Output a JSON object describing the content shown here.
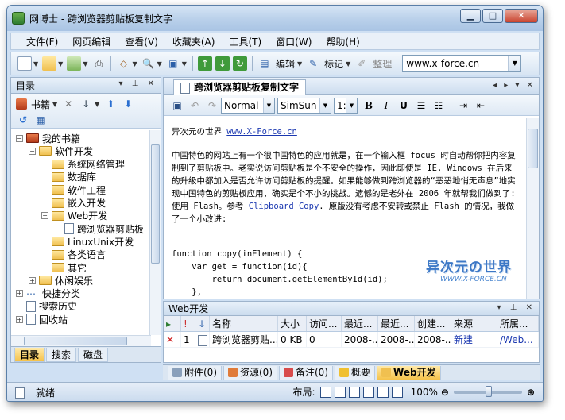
{
  "window": {
    "title": "网博士 - 跨浏览器剪贴板复制文字"
  },
  "menu": [
    "文件(F)",
    "网页编辑",
    "查看(V)",
    "收藏夹(A)",
    "工具(T)",
    "窗口(W)",
    "帮助(H)"
  ],
  "toolbar": {
    "edit_label": "编辑",
    "mark_label": "标记",
    "organize_label": "整理",
    "url_value": "www.x-force.cn"
  },
  "sidebar": {
    "title": "目录",
    "bookmarks_label": "书籍",
    "tree": [
      {
        "label": "我的书籍",
        "level": 0,
        "expand": "−",
        "type": "book"
      },
      {
        "label": "软件开发",
        "level": 1,
        "expand": "−",
        "type": "folder"
      },
      {
        "label": "系统网络管理",
        "level": 2,
        "expand": "",
        "type": "folder"
      },
      {
        "label": "数据库",
        "level": 2,
        "expand": "",
        "type": "folder"
      },
      {
        "label": "软件工程",
        "level": 2,
        "expand": "",
        "type": "folder"
      },
      {
        "label": "嵌入开发",
        "level": 2,
        "expand": "",
        "type": "folder"
      },
      {
        "label": "Web开发",
        "level": 2,
        "expand": "−",
        "type": "folder"
      },
      {
        "label": "跨浏览器剪贴板",
        "level": 3,
        "expand": "",
        "type": "doc"
      },
      {
        "label": "LinuxUnix开发",
        "level": 2,
        "expand": "",
        "type": "folder"
      },
      {
        "label": "各类语言",
        "level": 2,
        "expand": "",
        "type": "folder"
      },
      {
        "label": "其它",
        "level": 2,
        "expand": "",
        "type": "folder"
      },
      {
        "label": "休闲娱乐",
        "level": 1,
        "expand": "+",
        "type": "folder"
      },
      {
        "label": "快捷分类",
        "level": 0,
        "expand": "+",
        "type": "dots"
      },
      {
        "label": "搜索历史",
        "level": 0,
        "expand": "",
        "type": "doc"
      },
      {
        "label": "回收站",
        "level": 0,
        "expand": "+",
        "type": "doc"
      }
    ],
    "tabs": [
      "目录",
      "搜索",
      "磁盘"
    ]
  },
  "editor": {
    "tab_title": "跨浏览器剪贴板复制文字",
    "font_style": "Normal",
    "font_name": "SimSun-",
    "font_size": "1:",
    "content": {
      "site_name": "异次元の世界",
      "site_url": "www.X-Force.cn",
      "para_before_link": "中国特色的网站上有一个很中国特色的应用就是，在一个输入框 focus 时自动帮你把内容复制到了剪贴板中。老实说访问剪贴板是个不安全的操作，因此即使是 IE, Windows 在后来的升级中都加入是否允许访问剪贴板的提醒。如果能够做到跨浏览器的“恶恶地悄无声息”地实现中国特色的剪贴板应用，确实是个不小的挑战。遗憾的是老外在 2006 年就帮我们做到了: 使用 Flash。参考",
      "link_text": "Clipboard Copy",
      "para_after_link": ". 原版没有考虑不安转或禁止 Flash 的情况，我做了一个小改进:",
      "code": [
        "function copy(inElement) {",
        "    var get = function(id){",
        "        return document.getElementById(id);",
        "    },"
      ]
    },
    "watermark": {
      "main": "异次元の世界",
      "sub": "WWW.X-FORCE.CN"
    }
  },
  "list": {
    "title": "Web开发",
    "columns": [
      "名称",
      "大小",
      "访问...",
      "最近...",
      "最近...",
      "创建...",
      "来源",
      "所属..."
    ],
    "rows": [
      {
        "index": "1",
        "name": "跨浏览器剪贴...",
        "size": "0 KB",
        "visits": "0",
        "recent1": "2008-...",
        "recent2": "2008-...",
        "created": "2008-...",
        "source": "新建",
        "belongs": "/Web..."
      }
    ]
  },
  "bottom_tabs": [
    "附件(0)",
    "资源(0)",
    "备注(0)",
    "概要",
    "Web开发"
  ],
  "status": {
    "text": "就绪",
    "layout_label": "布局:",
    "zoom": "100%"
  }
}
